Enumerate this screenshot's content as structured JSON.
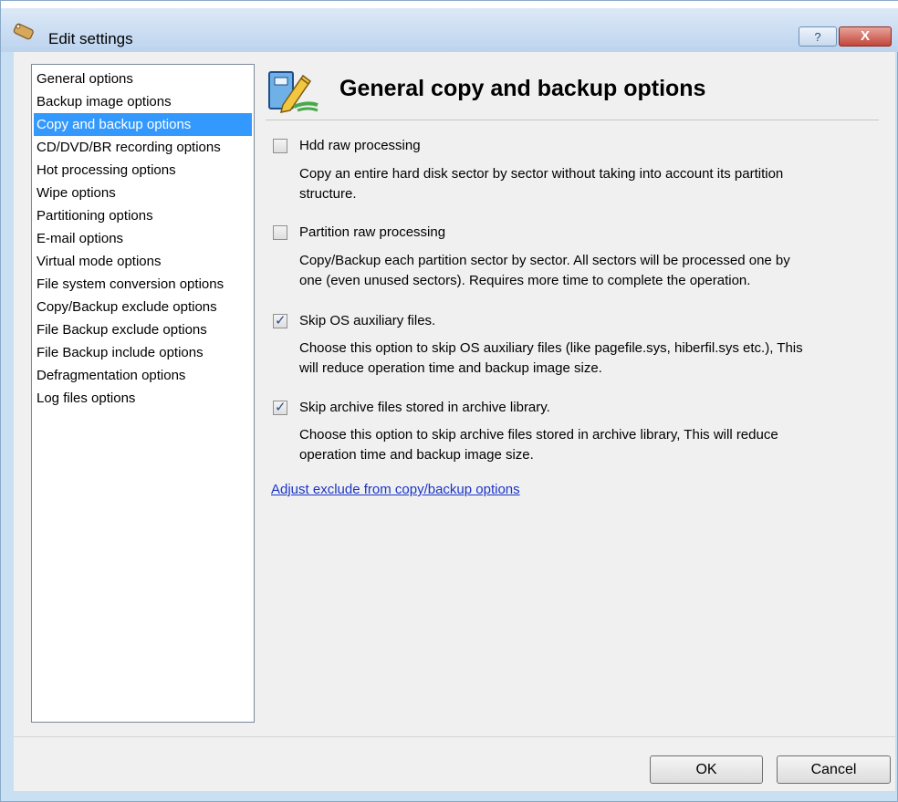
{
  "window": {
    "title": "Edit settings"
  },
  "titlebar": {
    "help_label": "?",
    "close_label": "X"
  },
  "sidebar": {
    "items": [
      {
        "label": "General options",
        "selected": false
      },
      {
        "label": "Backup image options",
        "selected": false
      },
      {
        "label": "Copy and backup options",
        "selected": true
      },
      {
        "label": "CD/DVD/BR recording options",
        "selected": false
      },
      {
        "label": "Hot processing options",
        "selected": false
      },
      {
        "label": "Wipe options",
        "selected": false
      },
      {
        "label": "Partitioning options",
        "selected": false
      },
      {
        "label": "E-mail options",
        "selected": false
      },
      {
        "label": "Virtual mode options",
        "selected": false
      },
      {
        "label": "File system conversion options",
        "selected": false
      },
      {
        "label": "Copy/Backup exclude options",
        "selected": false
      },
      {
        "label": "File Backup exclude options",
        "selected": false
      },
      {
        "label": "File Backup include options",
        "selected": false
      },
      {
        "label": "Defragmentation options",
        "selected": false
      },
      {
        "label": "Log files options",
        "selected": false
      }
    ]
  },
  "main": {
    "title": "General copy and backup options",
    "options": [
      {
        "label": "Hdd raw processing",
        "checked": false,
        "desc1": "Copy an entire hard disk sector by sector without taking into account its partition",
        "desc2": "structure."
      },
      {
        "label": "Partition raw processing",
        "checked": false,
        "desc1": "Copy/Backup each partition sector by sector. All sectors will be processed one by",
        "desc2": "one (even unused sectors). Requires more time to complete the operation."
      },
      {
        "label": "Skip OS auxiliary files.",
        "checked": true,
        "desc1": "Choose this option to skip OS auxiliary files (like pagefile.sys, hiberfil.sys etc.), This",
        "desc2": "will reduce operation time and backup image size."
      },
      {
        "label": "Skip archive files stored in archive library.",
        "checked": true,
        "desc1": "Choose this option to skip archive files stored in archive library, This will reduce",
        "desc2": "operation time and backup image size."
      }
    ],
    "link": "Adjust exclude from copy/backup options",
    "check_mark": "✓"
  },
  "footer": {
    "ok_label": "OK",
    "cancel_label": "Cancel"
  },
  "colors": {
    "selection": "#3399ff",
    "link": "#1a35c8",
    "close": "#c2463a"
  }
}
